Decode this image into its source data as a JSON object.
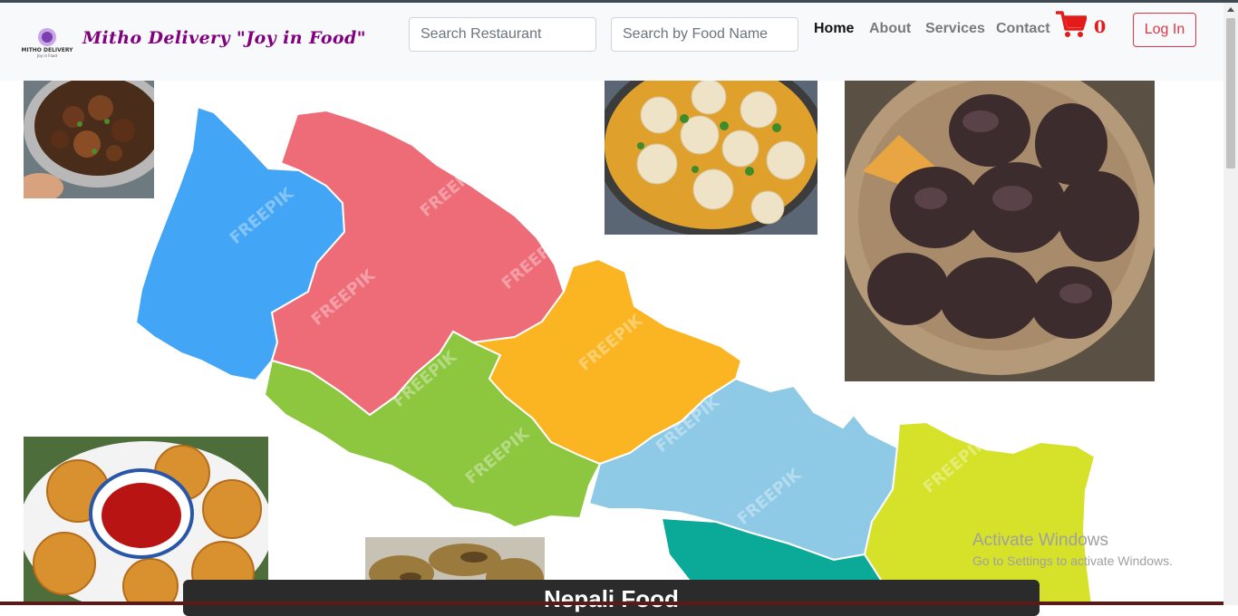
{
  "header": {
    "brand": "Mitho Delivery \"Joy in Food\"",
    "logo_text": "MITHO DELIVERY",
    "logo_tagline": "Joy in Food",
    "search_restaurant_placeholder": "Search Restaurant",
    "search_food_placeholder": "Search by Food Name",
    "nav": [
      {
        "label": "Home",
        "active": true
      },
      {
        "label": "About",
        "active": false
      },
      {
        "label": "Services",
        "active": false
      },
      {
        "label": "Contact",
        "active": false
      }
    ],
    "cart_count": "0",
    "login_label": "Log In"
  },
  "hero": {
    "caption": "Nepali Food",
    "map_watermark": "FREEPIK",
    "map_colors": [
      "#42a5f5",
      "#ee6c78",
      "#8dc63f",
      "#fbb522",
      "#8ecae6",
      "#0aa998",
      "#d6e22a"
    ]
  },
  "watermark": {
    "title": "Activate Windows",
    "subtitle": "Go to Settings to activate Windows."
  },
  "colors": {
    "brand": "#800080",
    "cart": "#e31b1b",
    "login": "#dc3545"
  }
}
